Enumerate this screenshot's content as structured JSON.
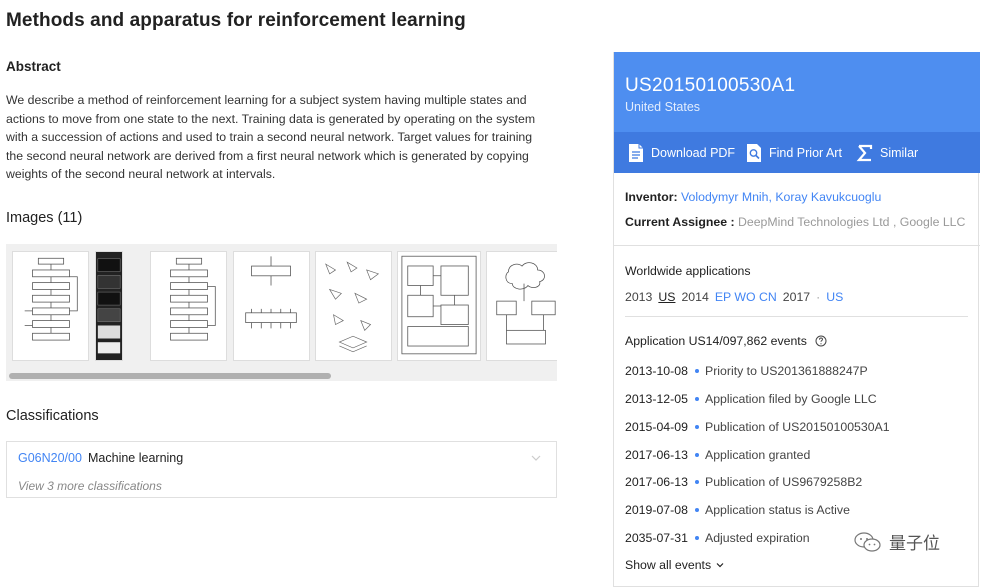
{
  "title": "Methods and apparatus for reinforcement learning",
  "abstract": {
    "heading": "Abstract",
    "lines": [
      "We describe a method of reinforcement learning for a subject system having multiple states and",
      "actions to move from one state to the next. Training data is generated by operating on the system",
      "with a succession of actions and used to train a second neural network. Target values for training",
      "the second neural network are derived from a first neural network which is generated by copying",
      "weights of the second neural network at intervals."
    ]
  },
  "images": {
    "heading": "Images (11)",
    "thumbnails": [
      "flowchart",
      "dark-screens",
      "flowchart",
      "diagram",
      "scatter-diagram",
      "block-diagram",
      "cloud-diagram"
    ]
  },
  "classifications": {
    "heading": "Classifications",
    "code": "G06N20/00",
    "label": "Machine learning",
    "more": "View 3 more classifications"
  },
  "patent": {
    "number": "US20150100530A1",
    "country": "United States",
    "actions": {
      "download": "Download PDF",
      "prior_art": "Find Prior Art",
      "similar": "Similar"
    },
    "inventor_label": "Inventor:",
    "inventors": "Volodymyr Mnih, Koray Kavukcuoglu",
    "assignee_label": "Current Assignee :",
    "assignee": "DeepMind Technologies Ltd , Google LLC"
  },
  "worldwide": {
    "heading": "Worldwide applications",
    "y2013": "2013",
    "c2013": "US",
    "y2014": "2014",
    "c2014": "EP WO CN",
    "y2017": "2017",
    "sep": "·",
    "c2017": "US"
  },
  "events": {
    "heading": "Application US14/097,862 events",
    "items": [
      {
        "date": "2013-10-08",
        "text": "Priority to US201361888247P"
      },
      {
        "date": "2013-12-05",
        "text": "Application filed by Google LLC"
      },
      {
        "date": "2015-04-09",
        "text": "Publication of US20150100530A1"
      },
      {
        "date": "2017-06-13",
        "text": "Application granted"
      },
      {
        "date": "2017-06-13",
        "text": "Publication of US9679258B2"
      },
      {
        "date": "2019-07-08",
        "text": "Application status is Active"
      },
      {
        "date": "2035-07-31",
        "text": "Adjusted expiration"
      }
    ],
    "show_all": "Show all events"
  },
  "watermark": "量子位",
  "colors": {
    "header_bg": "#4e8ef0",
    "toolbar_bg": "#3f7ae0",
    "link": "#4285f4"
  }
}
